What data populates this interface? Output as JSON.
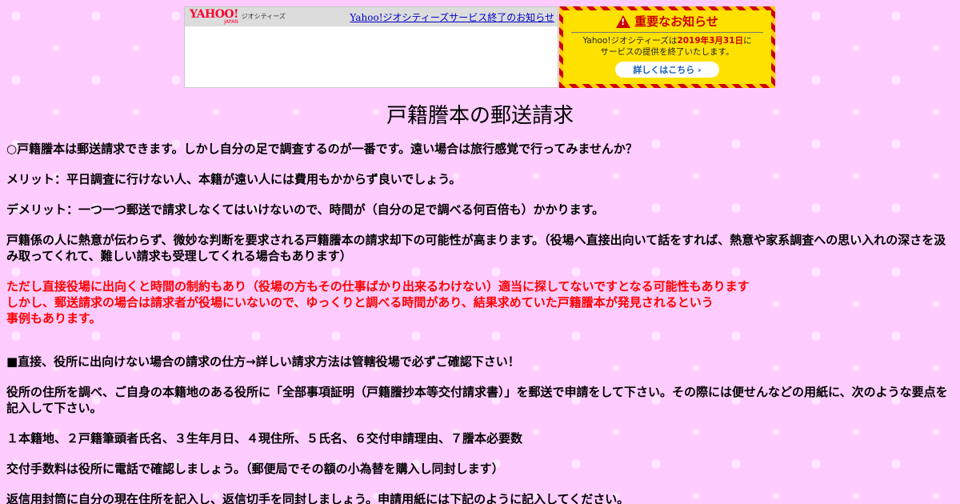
{
  "banner": {
    "logo_text": "YAHOO!",
    "logo_sub": "JAPAN",
    "logo_service": "ジオシティーズ",
    "link_text": "Yahoo!ジオシティーズサービス終了のお知らせ"
  },
  "notice": {
    "title": "重要なお知らせ",
    "line1_pre": "Yahoo!ジオシティーズは",
    "line1_date": "2019年3月31日",
    "line1_post": "に",
    "line2": "サービスの提供を終了いたします。",
    "button": "詳しくはこちら ›",
    "colors": {
      "stripe_red": "#cc0000",
      "stripe_yellow": "#ffcc00",
      "bg": "#ffe100"
    }
  },
  "page": {
    "title": "戸籍謄本の郵送請求",
    "paragraphs": [
      "○戸籍謄本は郵送請求できます。しかし自分の足で調査するのが一番です。遠い場合は旅行感覚で行ってみませんか？",
      "メリット：平日調査に行けない人、本籍が遠い人には費用もかからず良いでしょう。",
      "デメリット：一つ一つ郵送で請求しなくてはいけないので、時間が（自分の足で調べる何百倍も）かかります。",
      "戸籍係の人に熱意が伝わらず、微妙な判断を要求される戸籍謄本の請求却下の可能性が高まります。（役場へ直接出向いて話をすれば、熱意や家系調査への思い入れの深さを汲み取ってくれて、難しい請求も受理してくれる場合もあります）"
    ],
    "red_lines": [
      "ただし直接役場に出向くと時間の制約もあり（役場の方もその仕事ばかり出来るわけない）適当に探してないですとなる可能性もあります",
      "しかし、郵送請求の場合は請求者が役場にいないので、ゆっくりと調べる時間があり、結果求めていた戸籍謄本が発見されるという",
      "事例もあります。"
    ],
    "section2": [
      "■直接、役所に出向けない場合の請求の仕方→詳しい請求方法は管轄役場で必ずご確認下さい！",
      "役所の住所を調べ、ご自身の本籍地のある役所に「全部事項証明（戸籍謄抄本等交付請求書）」を郵送で申請をして下さい。その際には便せんなどの用紙に、次のような要点を記入して下さい。",
      "１本籍地、２戸籍筆頭者氏名、３生年月日、４現住所、５氏名、６交付申請理由、７謄本必要数",
      "交付手数料は役所に電話で確認しましょう。（郵便局でその額の小為替を購入し同封します）",
      "返信用封筒に自分の現在住所を記入し、返信切手を同封しましょう。申請用紙には下記のように記入してください。"
    ],
    "colors": {
      "background": "#ffccff",
      "red_text": "#ff0000"
    }
  }
}
